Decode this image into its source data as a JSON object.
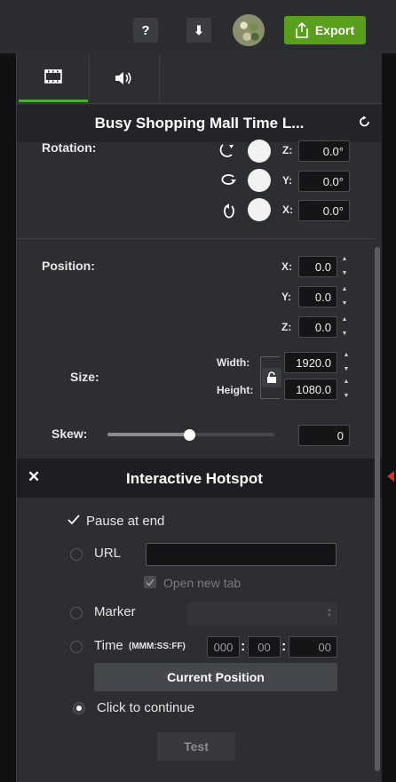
{
  "topbar": {
    "help_label": "?",
    "download_label": "⬇",
    "export_label": "Export"
  },
  "title": "Busy Shopping Mall Time L...",
  "rotation": {
    "label": "Rotation:",
    "axes": [
      {
        "axis": "Z:",
        "value": "0.0°"
      },
      {
        "axis": "Y:",
        "value": "0.0°"
      },
      {
        "axis": "X:",
        "value": "0.0°"
      }
    ]
  },
  "position": {
    "label": "Position:",
    "axes": [
      {
        "axis": "X:",
        "value": "0.0"
      },
      {
        "axis": "Y:",
        "value": "0.0"
      },
      {
        "axis": "Z:",
        "value": "0.0"
      }
    ]
  },
  "size": {
    "label": "Size:",
    "width_label": "Width:",
    "width_value": "1920.0",
    "height_label": "Height:",
    "height_value": "1080.0"
  },
  "skew": {
    "label": "Skew:",
    "value": "0",
    "slider_fraction": 0.5
  },
  "hotspot": {
    "close_label": "✕",
    "title": "Interactive Hotspot",
    "pause_label": "Pause at end",
    "pause_checked": true,
    "url_label": "URL",
    "url_value": "",
    "open_new_tab_label": "Open new tab",
    "marker_label": "Marker",
    "time_label": "Time",
    "time_format": "(MMM:SS:FF)",
    "time_min": "000",
    "time_sec": "00",
    "time_frames": "00",
    "current_position_label": "Current Position",
    "click_continue_label": "Click to continue",
    "test_label": "Test"
  },
  "colors": {
    "accent_green": "#5a9e1e",
    "tab_active": "#4cae2e",
    "marker_red": "#d0362b"
  }
}
